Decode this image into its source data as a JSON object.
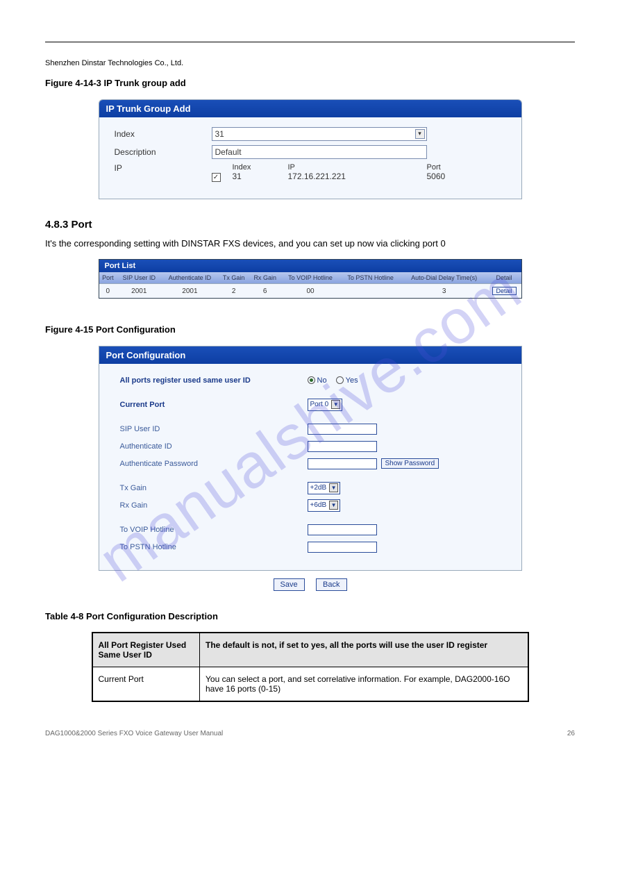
{
  "header": {
    "top_line": "Shenzhen Dinstar Technologies Co., Ltd.",
    "figure_caption_1": "Figure 4-14-3 IP Trunk group add",
    "section_port_title": "4.8.3 Port",
    "section_port_text": "It's the corresponding setting with DINSTAR FXS devices, and you can set up now via clicking port 0",
    "figure_caption_2": "Figure 4-15 Port Configuration",
    "expl_table_caption": "Table 4-8 Port Configuration Description"
  },
  "panel1": {
    "title": "IP Trunk Group Add",
    "labels": {
      "index": "Index",
      "description": "Description",
      "ip": "IP"
    },
    "index_value": "31",
    "description_value": "Default",
    "columns": {
      "index": "Index",
      "ip": "IP",
      "port": "Port"
    },
    "row": {
      "checked": "✓",
      "index": "31",
      "ip": "172.16.221.221",
      "port": "5060"
    }
  },
  "portlist": {
    "title": "Port List",
    "headers": [
      "Port",
      "SIP User ID",
      "Authenticate ID",
      "Tx Gain",
      "Rx Gain",
      "To VOIP Hotline",
      "To PSTN Hotline",
      "Auto-Dial Delay Time(s)",
      "Detail"
    ],
    "row": [
      "0",
      "2001",
      "2001",
      "2",
      "6",
      "00",
      "",
      "3"
    ],
    "detail_label": "Detail"
  },
  "portconf": {
    "title": "Port Configuration",
    "labels": {
      "all_ports": "All ports register used same user ID",
      "current_port": "Current Port",
      "sip_user_id": "SIP User ID",
      "auth_id": "Authenticate ID",
      "auth_pw": "Authenticate Password",
      "tx_gain": "Tx Gain",
      "rx_gain": "Rx Gain",
      "to_voip": "To VOIP Hotline",
      "to_pstn": "To PSTN Hotline"
    },
    "radio_no": "No",
    "radio_yes": "Yes",
    "current_port_value": "Port 0",
    "tx_gain_value": "+2dB",
    "rx_gain_value": "+6dB",
    "show_password": "Show Password",
    "save": "Save",
    "back": "Back"
  },
  "expl": {
    "h1": "All Port Register Used Same User ID",
    "h2": "Current Port",
    "c1": "The default is not, if set to yes, all the ports will use the user ID register",
    "c2": "You can select a port, and set correlative information. For example, DAG2000-16O have 16 ports (0-15)"
  },
  "footer": {
    "left": "DAG1000&2000 Series FXO Voice Gateway User Manual",
    "right": "26"
  },
  "watermark": "manualshive.com"
}
